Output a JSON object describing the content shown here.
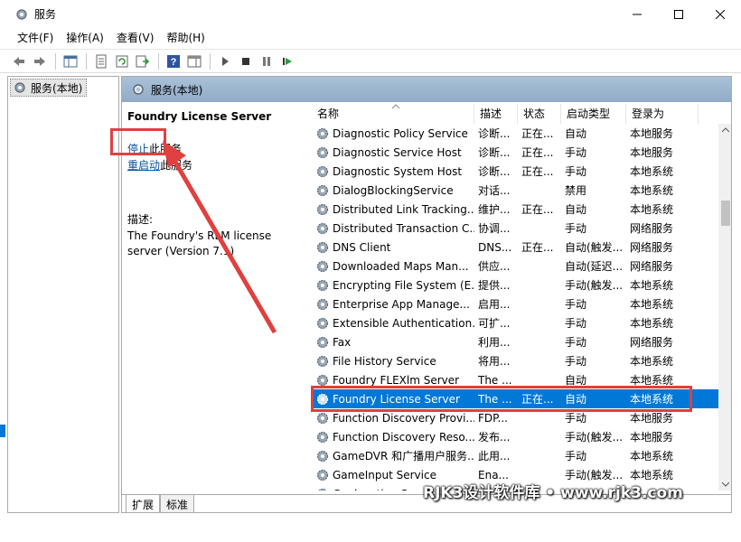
{
  "window": {
    "title": "服务",
    "controls": [
      "minimize-icon",
      "maximize-icon",
      "close-icon"
    ]
  },
  "menu": [
    "文件(F)",
    "操作(A)",
    "查看(V)",
    "帮助(H)"
  ],
  "tree": {
    "root_label": "服务(本地)"
  },
  "main": {
    "header_label": "服务(本地)",
    "detail": {
      "service_name": "Foundry License Server",
      "stop_link": "停止",
      "stop_suffix": "此服务",
      "restart_link": "重启动",
      "restart_suffix": "此服务",
      "desc_label": "描述:",
      "description": "The Foundry's RLM license server (Version 7.1)"
    },
    "columns": [
      "名称",
      "描述",
      "状态",
      "启动类型",
      "登录为"
    ],
    "rows": [
      {
        "name": "Diagnostic Policy Service",
        "desc": "诊断...",
        "status": "正在...",
        "startup": "自动",
        "logon": "本地服务"
      },
      {
        "name": "Diagnostic Service Host",
        "desc": "诊断...",
        "status": "正在...",
        "startup": "手动",
        "logon": "本地服务"
      },
      {
        "name": "Diagnostic System Host",
        "desc": "诊断...",
        "status": "正在...",
        "startup": "手动",
        "logon": "本地系统"
      },
      {
        "name": "DialogBlockingService",
        "desc": "对话...",
        "status": "",
        "startup": "禁用",
        "logon": "本地系统"
      },
      {
        "name": "Distributed Link Tracking...",
        "desc": "维护...",
        "status": "正在...",
        "startup": "自动",
        "logon": "本地系统"
      },
      {
        "name": "Distributed Transaction C...",
        "desc": "协调...",
        "status": "",
        "startup": "手动",
        "logon": "网络服务"
      },
      {
        "name": "DNS Client",
        "desc": "DNS...",
        "status": "正在...",
        "startup": "自动(触发...",
        "logon": "网络服务"
      },
      {
        "name": "Downloaded Maps Man...",
        "desc": "供应...",
        "status": "",
        "startup": "自动(延迟...",
        "logon": "网络服务"
      },
      {
        "name": "Encrypting File System (E...",
        "desc": "提供...",
        "status": "",
        "startup": "手动(触发...",
        "logon": "本地系统"
      },
      {
        "name": "Enterprise App Manage...",
        "desc": "启用...",
        "status": "",
        "startup": "手动",
        "logon": "本地系统"
      },
      {
        "name": "Extensible Authentication...",
        "desc": "可扩...",
        "status": "",
        "startup": "手动",
        "logon": "本地系统"
      },
      {
        "name": "Fax",
        "desc": "利用...",
        "status": "",
        "startup": "手动",
        "logon": "网络服务"
      },
      {
        "name": "File History Service",
        "desc": "将用...",
        "status": "",
        "startup": "手动",
        "logon": "本地系统"
      },
      {
        "name": "Foundry FLEXlm Server",
        "desc": "The ...",
        "status": "",
        "startup": "自动",
        "logon": "本地系统"
      },
      {
        "name": "Foundry License Server",
        "desc": "The ...",
        "status": "正在...",
        "startup": "自动",
        "logon": "本地系统",
        "selected": true
      },
      {
        "name": "Function Discovery Provi...",
        "desc": "FDP...",
        "status": "",
        "startup": "手动",
        "logon": "本地服务"
      },
      {
        "name": "Function Discovery Reso...",
        "desc": "发布...",
        "status": "",
        "startup": "手动(触发...",
        "logon": "本地服务"
      },
      {
        "name": "GameDVR 和广播用户服务...",
        "desc": "此用...",
        "status": "",
        "startup": "手动",
        "logon": "本地系统"
      },
      {
        "name": "GameInput Service",
        "desc": "Ena...",
        "status": "",
        "startup": "手动(触发...",
        "logon": "本地系统"
      },
      {
        "name": "Geolocation Service",
        "desc": "",
        "status": "",
        "startup": "",
        "logon": ""
      }
    ]
  },
  "tabs": [
    "扩展",
    "标准"
  ],
  "watermark": "RJK3设计软件库 • www.rjk3.com",
  "colors": {
    "selection": "#0078d7",
    "annotation": "#e0403f",
    "header_bg": "#a9c2d9",
    "link": "#0a50a0"
  }
}
